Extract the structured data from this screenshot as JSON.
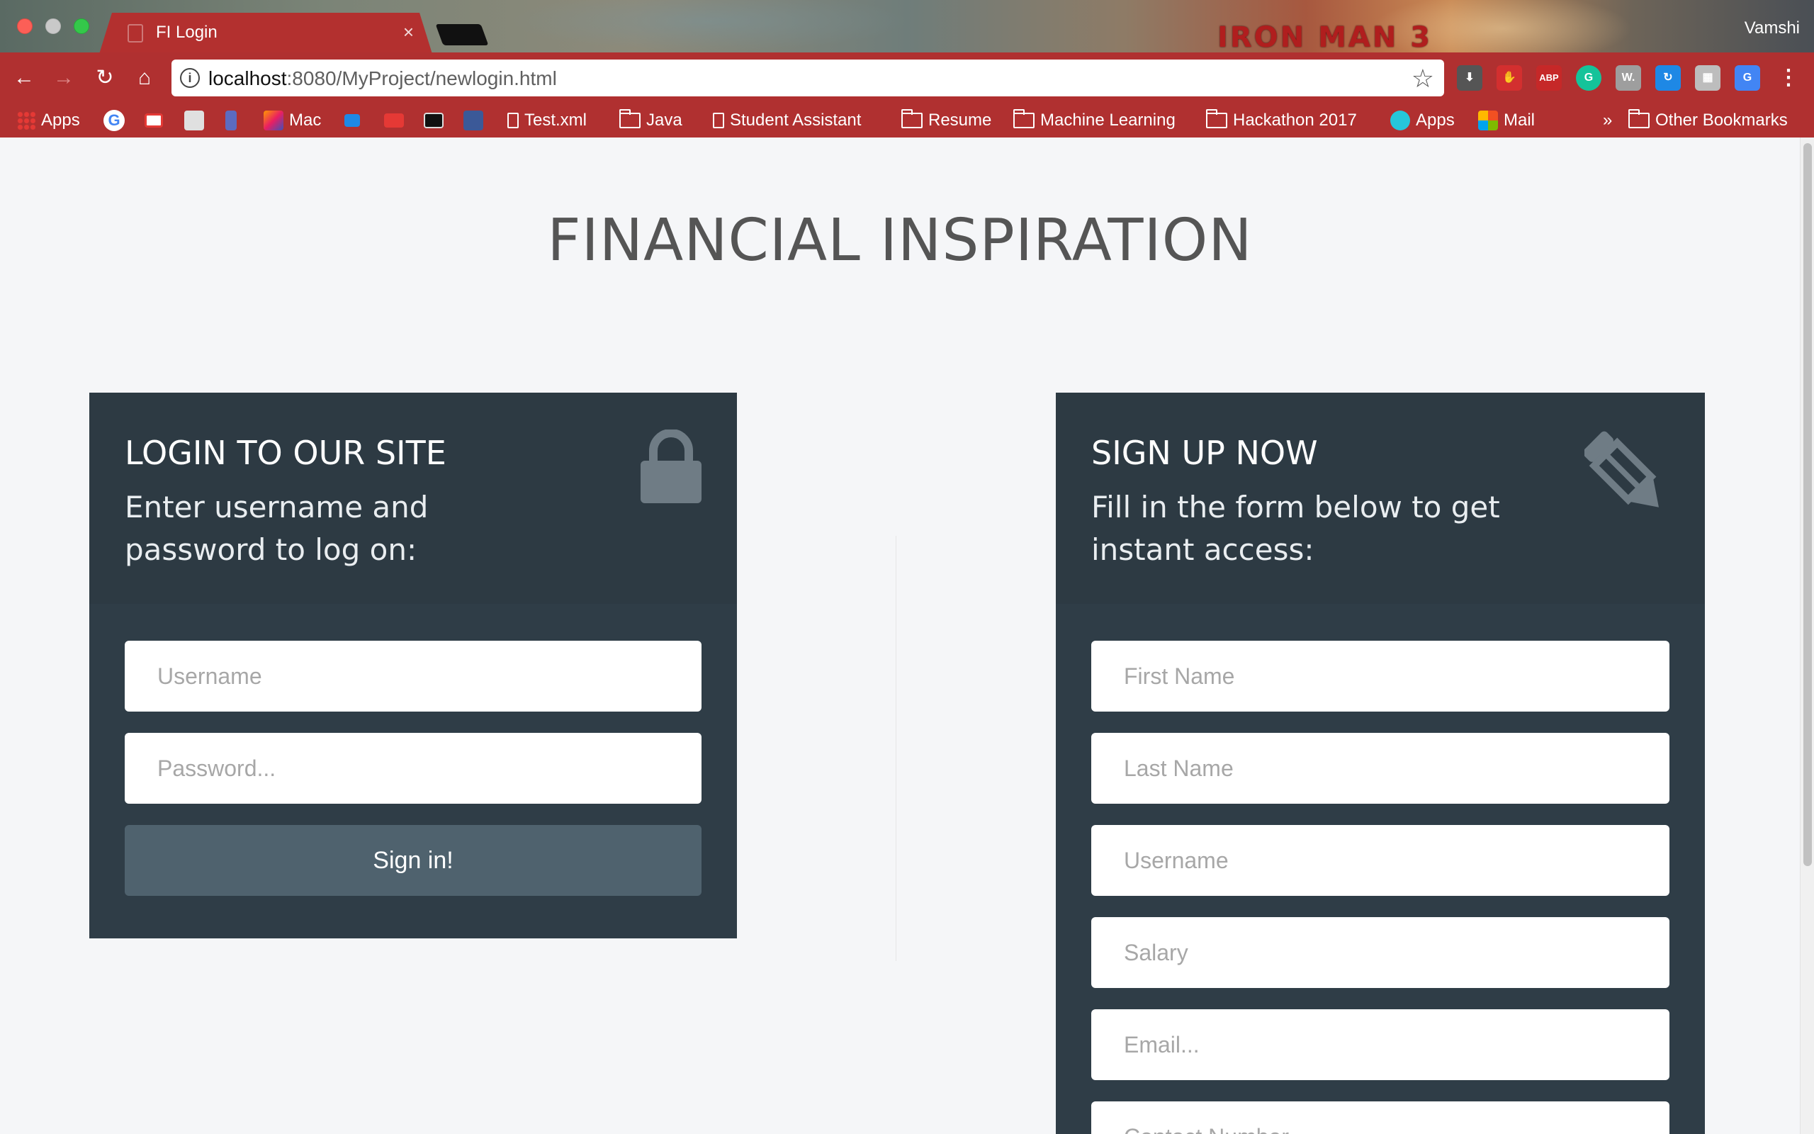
{
  "browser": {
    "tab_title": "FI Login",
    "tab_close": "×",
    "profile_name": "Vamshi",
    "movie_logo": "IRON MAN 3",
    "url_host": "localhost",
    "url_path": ":8080/MyProject/newlogin.html",
    "nav": {
      "back": "←",
      "forward": "→",
      "reload": "↻",
      "home": "⌂",
      "star": "☆",
      "menu": "⋮",
      "info": "i"
    },
    "extensions": [
      {
        "name": "download-ext-icon",
        "label": "⬇",
        "color": "#555555"
      },
      {
        "name": "adblock-ext-icon",
        "label": "✋",
        "color": "#d32f2f"
      },
      {
        "name": "abp-ext-icon",
        "label": "ABP",
        "color": "#c62828"
      },
      {
        "name": "grammarly-ext-icon",
        "label": "G",
        "color": "#15c39a"
      },
      {
        "name": "w-ext-icon",
        "label": "W.",
        "color": "#9e9e9e"
      },
      {
        "name": "sync-ext-icon",
        "label": "↻",
        "color": "#1e88e5"
      },
      {
        "name": "chart-ext-icon",
        "label": "▦",
        "color": "#bdbdbd"
      },
      {
        "name": "translate-ext-icon",
        "label": "G",
        "color": "#4285f4"
      }
    ],
    "bookmarks": {
      "apps_label": "Apps",
      "mac_label": "Mac",
      "items": [
        {
          "name": "bookmark-test-xml",
          "label": "Test.xml",
          "type": "page"
        },
        {
          "name": "bookmark-java",
          "label": "Java",
          "type": "folder"
        },
        {
          "name": "bookmark-student-assistant",
          "label": "Student Assistant",
          "type": "page"
        },
        {
          "name": "bookmark-resume",
          "label": "Resume",
          "type": "folder"
        },
        {
          "name": "bookmark-machine-learning",
          "label": "Machine Learning",
          "type": "folder"
        },
        {
          "name": "bookmark-hackathon-2017",
          "label": "Hackathon 2017",
          "type": "folder"
        },
        {
          "name": "bookmark-apps",
          "label": "Apps",
          "type": "app"
        },
        {
          "name": "bookmark-mail",
          "label": "Mail",
          "type": "mail"
        }
      ],
      "overflow": "»",
      "other_label": "Other Bookmarks"
    }
  },
  "page": {
    "title": "FINANCIAL INSPIRATION",
    "login": {
      "title": "LOGIN TO OUR SITE",
      "subtitle": "Enter username and password to log on:",
      "username_placeholder": "Username",
      "password_placeholder": "Password...",
      "submit_label": "Sign in!"
    },
    "signup": {
      "title": "SIGN UP NOW",
      "subtitle": "Fill in the form below to get instant access:",
      "first_name_placeholder": "First Name",
      "last_name_placeholder": "Last Name",
      "username_placeholder": "Username",
      "salary_placeholder": "Salary",
      "email_placeholder": "Email...",
      "contact_placeholder": "Contact Number"
    }
  },
  "colors": {
    "card_bg": "#2f3d47",
    "button_bg": "#4f626e",
    "page_bg": "#f5f6f8",
    "chrome_red": "#b03030"
  }
}
